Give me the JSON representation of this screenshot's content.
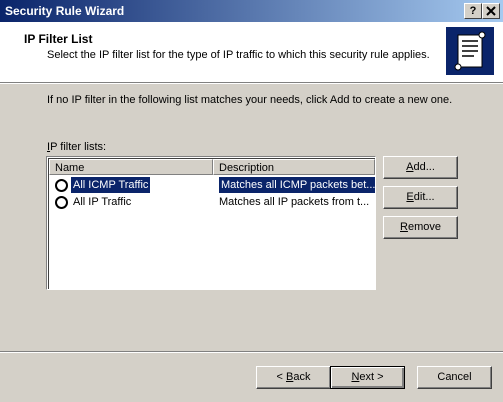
{
  "window": {
    "title": "Security Rule Wizard",
    "help_label": "?",
    "close_label": "X"
  },
  "header": {
    "title": "IP Filter List",
    "subtitle": "Select the IP filter list for the type of IP traffic to which this security rule applies."
  },
  "info_text": "If no IP filter in the following list matches your needs, click Add to create a new one.",
  "list": {
    "label_prefix": "I",
    "label_rest": "P filter lists:",
    "columns": [
      "Name",
      "Description"
    ],
    "rows": [
      {
        "name": "All ICMP Traffic",
        "description": "Matches all ICMP packets bet...",
        "selected": true
      },
      {
        "name": "All IP Traffic",
        "description": "Matches all IP packets from t...",
        "selected": false
      }
    ]
  },
  "side_buttons": {
    "add": {
      "u": "A",
      "rest": "dd..."
    },
    "edit": {
      "u": "E",
      "rest": "dit..."
    },
    "remove": {
      "u": "R",
      "rest": "emove"
    }
  },
  "footer": {
    "back": {
      "pre": "< ",
      "u": "B",
      "rest": "ack"
    },
    "next": {
      "u": "N",
      "rest": "ext >"
    },
    "cancel": "Cancel"
  },
  "colors": {
    "selection": "#0a246a",
    "dialog_bg": "#d4d0c8"
  },
  "icons": {
    "header": "scroll-icon"
  }
}
